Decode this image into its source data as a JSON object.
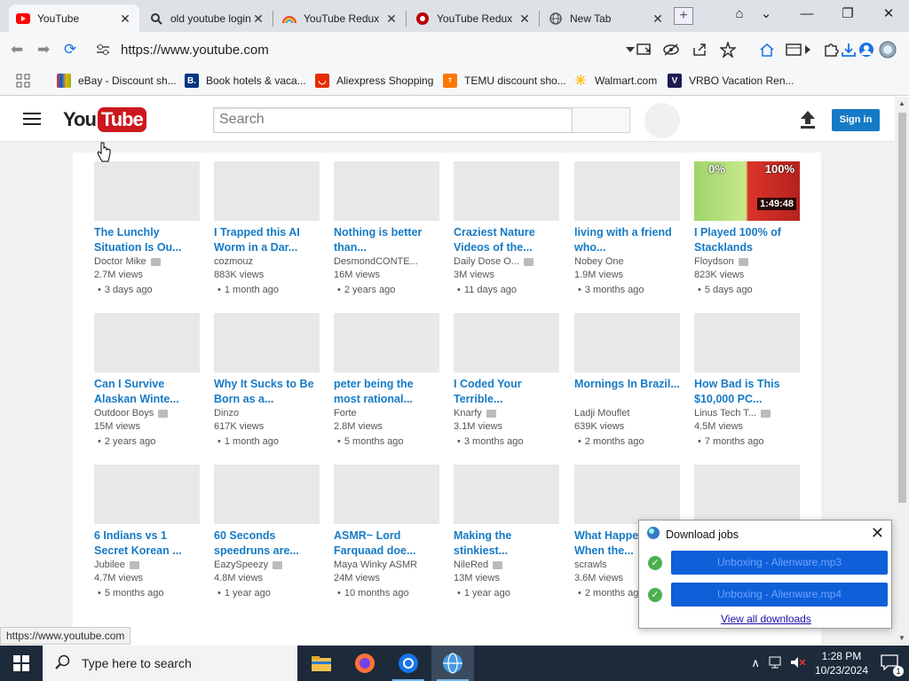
{
  "browser": {
    "tabs": [
      {
        "title": "YouTube",
        "active": true,
        "favicon": "youtube-icon"
      },
      {
        "title": "old youtube login",
        "active": false,
        "favicon": "search-icon"
      },
      {
        "title": "YouTube Redux",
        "active": false,
        "favicon": "rainbow-icon"
      },
      {
        "title": "YouTube Redux",
        "active": false,
        "favicon": "youtube-redux-icon"
      },
      {
        "title": "New Tab",
        "active": false,
        "favicon": "globe-icon"
      }
    ],
    "url": "https://www.youtube.com",
    "bookmarks": [
      {
        "label": "eBay - Discount sh...",
        "icon": "ebay-icon",
        "color": "#e53238"
      },
      {
        "label": "Hotels & vaca...",
        "prefix": "Book hotels & vaca...",
        "icon": "booking-icon",
        "color": "#003580"
      },
      {
        "label": "Aliexpress Shopping",
        "icon": "aliexpress-icon",
        "color": "#e62e04"
      },
      {
        "label": "TEMU discount sho...",
        "icon": "temu-icon",
        "color": "#fb7701"
      },
      {
        "label": "Walmart.com",
        "icon": "walmart-icon",
        "color": "#ffc220"
      },
      {
        "label": "VRBO Vacation Ren...",
        "icon": "vrbo-icon",
        "color": "#1c1c50"
      }
    ],
    "status_url": "https://www.youtube.com"
  },
  "youtube": {
    "search_placeholder": "Search",
    "signin_label": "Sign in",
    "logo_you": "You",
    "logo_tube": "Tube",
    "videos": [
      {
        "title": "The Lunchly Situation Is Ou...",
        "channel": "Doctor Mike",
        "verified": true,
        "views": "2.7M views",
        "age": "3 days ago"
      },
      {
        "title": "I Trapped this AI Worm in a Dar...",
        "channel": "cozmouz",
        "verified": false,
        "views": "883K views",
        "age": "1 month ago"
      },
      {
        "title": "Nothing is better than...",
        "channel": "DesmondCONTE...",
        "verified": false,
        "views": "16M views",
        "age": "2 years ago"
      },
      {
        "title": "Craziest Nature Videos of the...",
        "channel": "Daily Dose O...",
        "verified": true,
        "views": "3M views",
        "age": "11 days ago"
      },
      {
        "title": "living with a friend who...",
        "channel": "Nobey One",
        "verified": false,
        "views": "1.9M views",
        "age": "3 months ago"
      },
      {
        "title": "I Played 100% of Stacklands",
        "channel": "Floydson",
        "verified": true,
        "views": "823K views",
        "age": "5 days ago",
        "duration": "1:49:48",
        "thumb_left": "0%",
        "thumb_right": "100%"
      },
      {
        "title": "Can I Survive Alaskan Winte...",
        "channel": "Outdoor Boys",
        "verified": true,
        "views": "15M views",
        "age": "2 years ago"
      },
      {
        "title": "Why It Sucks to Be Born as a...",
        "channel": "Dinzo",
        "verified": false,
        "views": "617K views",
        "age": "1 month ago"
      },
      {
        "title": "peter being the most rational...",
        "channel": "Forte",
        "verified": false,
        "views": "2.8M views",
        "age": "5 months ago"
      },
      {
        "title": "I Coded Your Terrible...",
        "channel": "Knarfy",
        "verified": true,
        "views": "3.1M views",
        "age": "3 months ago"
      },
      {
        "title": "Mornings In Brazil...",
        "channel": "Ladji Mouflet",
        "verified": false,
        "views": "639K views",
        "age": "2 months ago"
      },
      {
        "title": "How Bad is This $10,000 PC...",
        "channel": "Linus Tech T...",
        "verified": true,
        "views": "4.5M views",
        "age": "7 months ago"
      },
      {
        "title": "6 Indians vs 1 Secret Korean ...",
        "channel": "Jubilee",
        "verified": true,
        "views": "4.7M views",
        "age": "5 months ago"
      },
      {
        "title": "60 Seconds speedruns are...",
        "channel": "EazySpeezy",
        "verified": true,
        "views": "4.8M views",
        "age": "1 year ago"
      },
      {
        "title": "ASMR~ Lord Farquaad doe...",
        "channel": "Maya Winky ASMR",
        "verified": false,
        "views": "24M views",
        "age": "10 months ago"
      },
      {
        "title": "Making the stinkiest...",
        "channel": "NileRed",
        "verified": true,
        "views": "13M views",
        "age": "1 year ago"
      },
      {
        "title": "What Happens When the...",
        "channel": "scrawls",
        "verified": false,
        "views": "3.6M views",
        "age": "2 months ago"
      },
      {
        "title": "",
        "channel": "",
        "verified": false,
        "views": "",
        "age": ""
      }
    ]
  },
  "downloads": {
    "title": "Download jobs",
    "jobs": [
      {
        "label": "Unboxing - Alienware.mp3"
      },
      {
        "label": "Unboxing - Alienware.mp4"
      }
    ],
    "view_all": "View all downloads"
  },
  "taskbar": {
    "search_placeholder": "Type here to search",
    "time": "1:28 PM",
    "date": "10/23/2024",
    "notification_count": "1"
  },
  "colors": {
    "yt_blue": "#167ac6",
    "yt_red": "#cc181e",
    "download_blue": "#0e5fd8"
  }
}
